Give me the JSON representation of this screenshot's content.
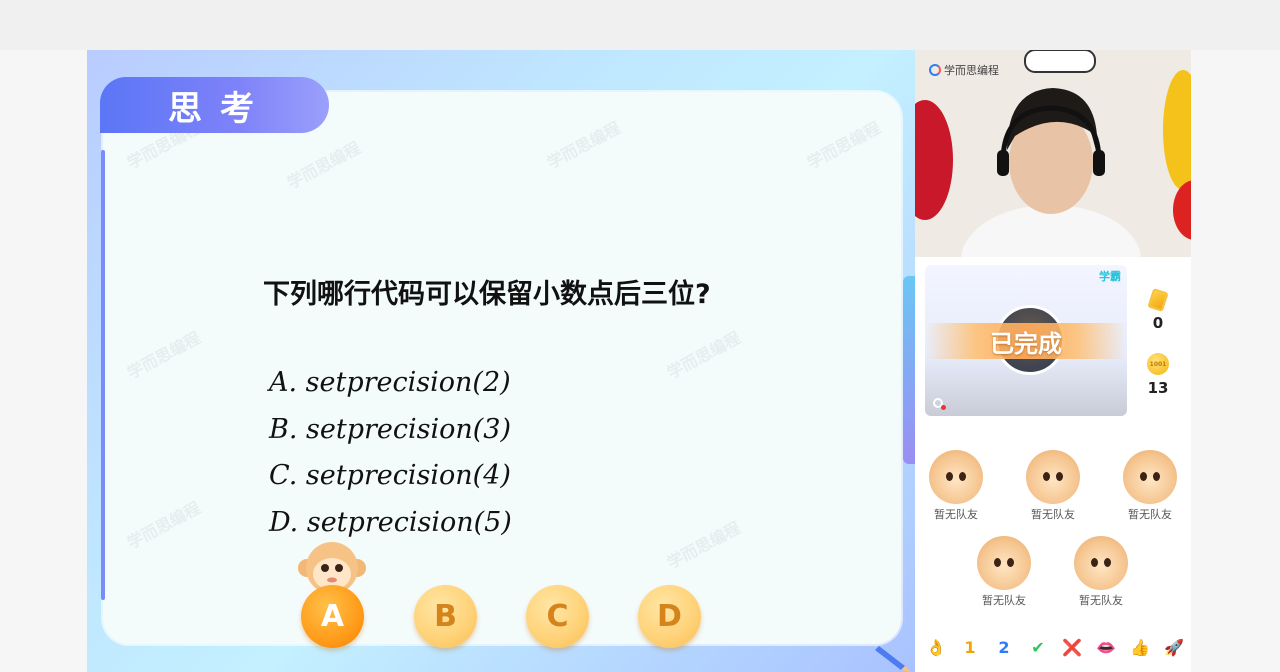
{
  "slide": {
    "tab_title": "思考",
    "question": "下列哪行代码可以保留小数点后三位?",
    "options": [
      "A. setprecision(2)",
      "B. setprecision(3)",
      "C. setprecision(4)",
      "D. setprecision(5)"
    ],
    "watermark": "学而思编程",
    "answer_buttons": [
      "A",
      "B",
      "C",
      "D"
    ],
    "selected_answer": "A"
  },
  "video": {
    "brand": "学而思编程"
  },
  "status": {
    "role_tag": "学霸",
    "completion_text": "已完成",
    "cards_count": "0",
    "coins_count": "13",
    "coin_label": "1001"
  },
  "teams": [
    {
      "label": "暂无队友"
    },
    {
      "label": "暂无队友"
    },
    {
      "label": "暂无队友"
    },
    {
      "label": "暂无队友"
    },
    {
      "label": "暂无队友"
    }
  ],
  "reactions": [
    "👌",
    "1",
    "2",
    "✔",
    "❌",
    "👄",
    "👍",
    "🚀"
  ],
  "colors": {
    "title_gradient_start": "#5b76f6",
    "answer_selected": "#ff9c1a",
    "answer_default": "#ffd37a",
    "role_tag": "#29c3d9"
  }
}
